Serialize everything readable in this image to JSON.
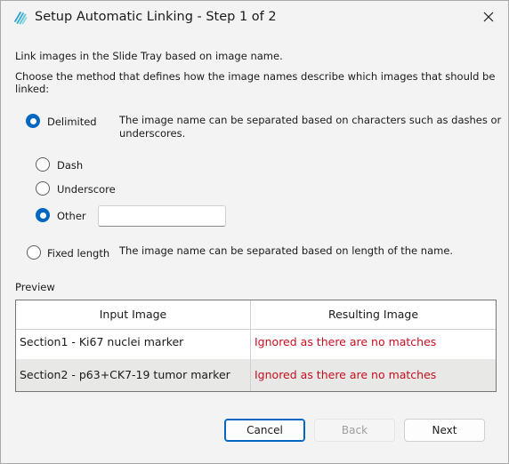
{
  "window": {
    "title": "Setup Automatic Linking - Step 1 of 2"
  },
  "intro": {
    "line1": "Link images in the Slide Tray based on image name.",
    "line2a": "Choose the method that defines how the image names describe which images that should be",
    "line2b": "linked:"
  },
  "methods": {
    "delimited": {
      "label": "Delimited",
      "checked": true,
      "desc1": "The image name can be separated based on characters such as dashes or",
      "desc2": "underscores."
    },
    "delimiters": [
      {
        "label": "Dash",
        "checked": false
      },
      {
        "label": "Underscore",
        "checked": false
      },
      {
        "label": "Other",
        "checked": true
      }
    ],
    "other_value": "",
    "fixed_length": {
      "label": "Fixed length",
      "checked": false,
      "desc": "The image name can be separated based on length of the name."
    }
  },
  "preview": {
    "label": "Preview",
    "columns": [
      "Input Image",
      "Resulting Image"
    ],
    "rows": [
      {
        "input": "Section1 - Ki67 nuclei marker",
        "result": "Ignored as there are no matches"
      },
      {
        "input": "Section2 - p63+CK7-19 tumor marker",
        "result": "Ignored as there are no matches"
      }
    ]
  },
  "buttons": {
    "cancel": "Cancel",
    "back": "Back",
    "next": "Next"
  },
  "colors": {
    "accent": "#0067c0",
    "error_text": "#c50f1f",
    "selected_row": "#e8e8e6"
  }
}
